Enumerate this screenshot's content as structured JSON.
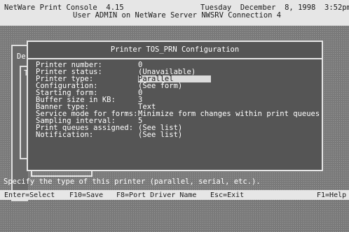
{
  "header": {
    "app_title": "NetWare Print Console  4.15",
    "date": "Tuesday  December  8, 1998  3:52pm",
    "user_line": "User ADMIN on NetWare Server NWSRV Connection 4"
  },
  "background": {
    "left_label_1": "De",
    "left_label_2": "T"
  },
  "dialog": {
    "title": "Printer TOS_PRN Configuration",
    "fields": [
      {
        "label": "Printer number:",
        "value": "0"
      },
      {
        "label": "Printer status:",
        "value": "(Unavailable)"
      },
      {
        "label": "Printer type:",
        "value": "Parallel"
      },
      {
        "label": "Configuration:",
        "value": "(See form)"
      },
      {
        "label": "Starting form:",
        "value": "0"
      },
      {
        "label": "Buffer size in KB:",
        "value": "3"
      },
      {
        "label": "Banner type:",
        "value": "Text"
      },
      {
        "label": "Service mode for forms:",
        "value": "Minimize form changes within print queues"
      },
      {
        "label": "Sampling interval:",
        "value": "5"
      },
      {
        "label": "Print queues assigned:",
        "value": "(See list)"
      },
      {
        "label": "Notification:",
        "value": "(See list)"
      }
    ]
  },
  "status_message": "Specify the type of this printer (parallel, serial, etc.).",
  "bottom_bar": {
    "enter": "Enter=Select",
    "f10": "F10=Save",
    "f8": "F8=Port Driver Name",
    "esc": "Esc=Exit",
    "f1": "F1=Help"
  },
  "colors": {
    "screen_bg": "#7a7a7a",
    "header_bg": "#e6e6e6",
    "dialog_bg": "#555555",
    "selection_bg": "#dcdcdc"
  }
}
